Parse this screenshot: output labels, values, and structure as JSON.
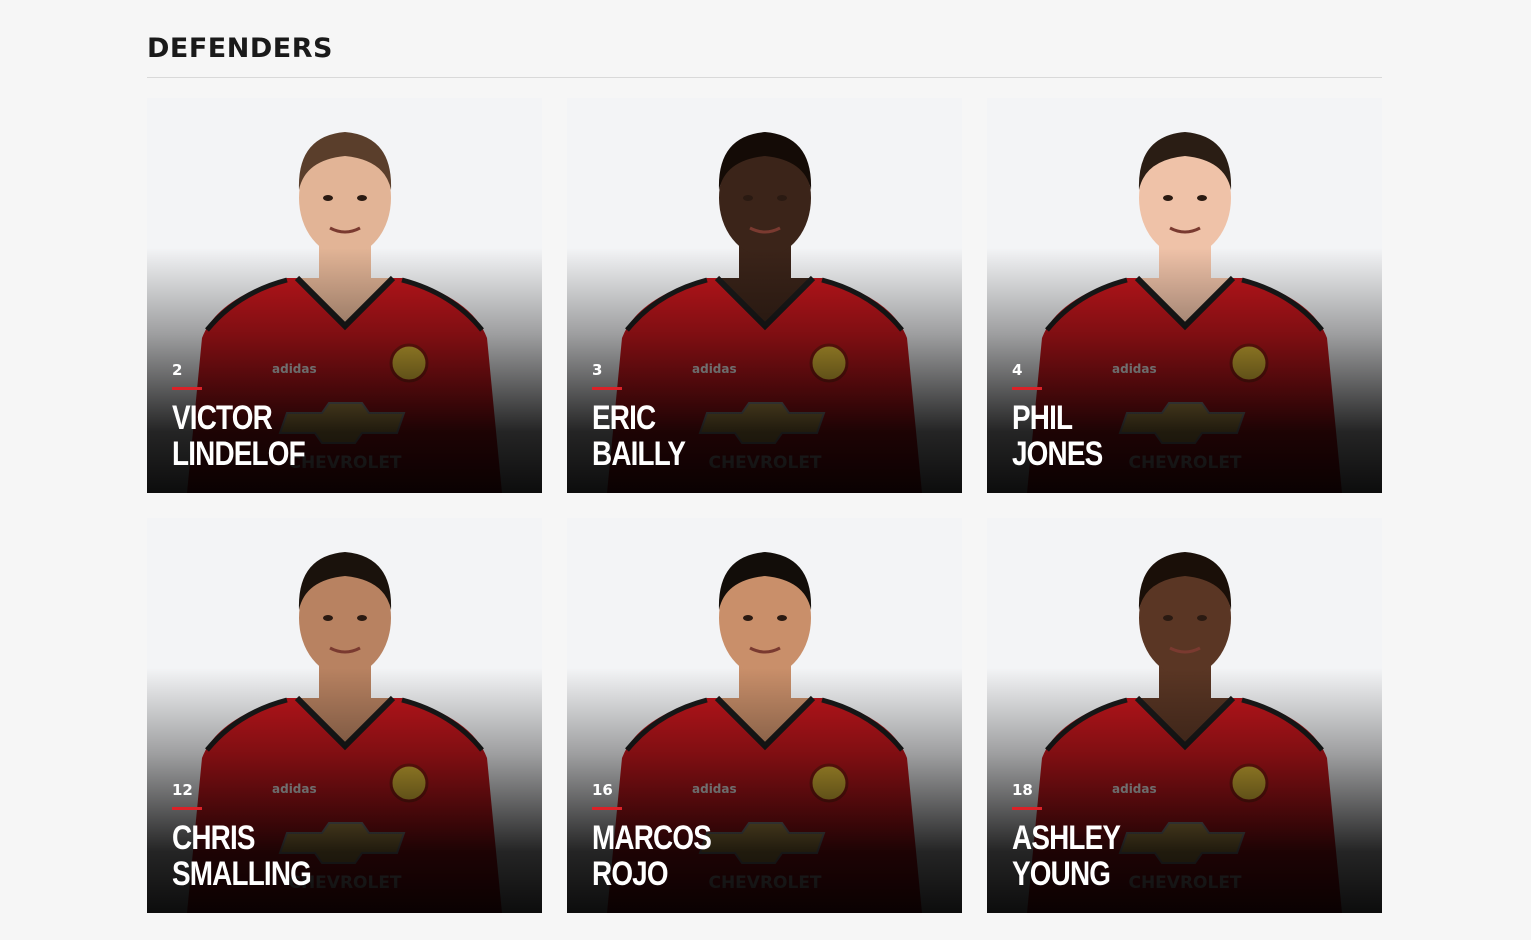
{
  "section": {
    "title": "DEFENDERS"
  },
  "colors": {
    "accent": "#da2128",
    "shirt": "#c4161c",
    "background": "#f6f6f6"
  },
  "players": [
    {
      "number": "2",
      "first": "VICTOR",
      "last": "LINDELOF",
      "skin": "#e2b496",
      "hair": "#5a3e2b"
    },
    {
      "number": "3",
      "first": "ERIC",
      "last": "BAILLY",
      "skin": "#3b2419",
      "hair": "#140b06"
    },
    {
      "number": "4",
      "first": "PHIL",
      "last": "JONES",
      "skin": "#efc2a8",
      "hair": "#2a1d14"
    },
    {
      "number": "12",
      "first": "CHRIS",
      "last": "SMALLING",
      "skin": "#b88261",
      "hair": "#1a120c"
    },
    {
      "number": "16",
      "first": "MARCOS",
      "last": "ROJO",
      "skin": "#c98f6a",
      "hair": "#120d09"
    },
    {
      "number": "18",
      "first": "ASHLEY",
      "last": "YOUNG",
      "skin": "#5a3624",
      "hair": "#1a0f08"
    }
  ],
  "shirt": {
    "sponsor": "CHEVROLET",
    "maker": "adidas"
  }
}
